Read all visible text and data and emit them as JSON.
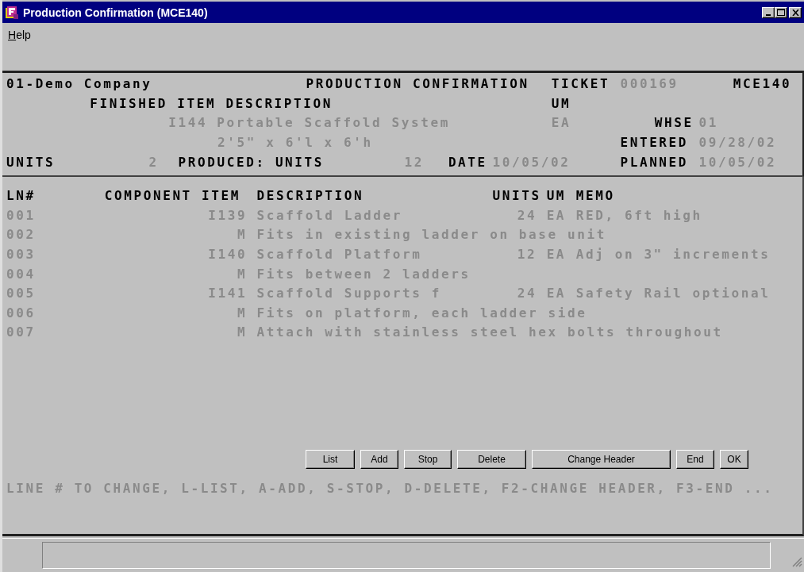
{
  "window": {
    "title": "Production Confirmation (MCE140)"
  },
  "menu": [
    "Help"
  ],
  "header": {
    "company": "01-Demo Company",
    "title": "PRODUCTION CONFIRMATION",
    "ticket_label": "TICKET",
    "ticket": "000169",
    "program": "MCE140",
    "description_label": "FINISHED ITEM DESCRIPTION",
    "um_label": "UM",
    "item": "I144 Portable Scaffold System",
    "um": "EA",
    "whse_label": "WHSE",
    "whse": "01",
    "item_size": "2'5\" x 6'l x 6'h",
    "entered_label": "ENTERED",
    "entered": "09/28/02",
    "units_label": "UNITS",
    "units": "2",
    "produced_label": "PRODUCED: UNITS",
    "produced": "12",
    "date_label": "DATE",
    "date": "10/05/02",
    "planned_label": "PLANNED",
    "planned": "10/05/02"
  },
  "table": {
    "columns": [
      "LN#",
      "COMPONENT ITEM",
      "DESCRIPTION",
      "UNITS",
      "UM",
      "MEMO"
    ],
    "rows": [
      {
        "line": "001",
        "item": "I139",
        "description": "Scaffold Ladder",
        "units": "24",
        "um": "EA",
        "memo": "RED, 6ft high"
      },
      {
        "line": "002",
        "item": "M",
        "description": "Fits in existing ladder on base unit"
      },
      {
        "line": "003",
        "item": "I140",
        "description": "Scaffold Platform",
        "units": "12",
        "um": "EA",
        "memo": "Adj on 3\" increments"
      },
      {
        "line": "004",
        "item": "M",
        "description": "Fits between 2 ladders"
      },
      {
        "line": "005",
        "item": "I141",
        "description": "Scaffold Supports f",
        "units": "24",
        "um": "EA",
        "memo": "Safety Rail optional"
      },
      {
        "line": "006",
        "item": "M",
        "description": "Fits on platform, each ladder side"
      },
      {
        "line": "007",
        "item": "M",
        "description": "Attach with stainless steel hex bolts throughout"
      }
    ]
  },
  "buttons": [
    "List",
    "Add",
    "Stop",
    "Delete",
    "Change Header",
    "End",
    "OK"
  ],
  "prompt": "LINE # TO CHANGE, L-LIST, A-ADD, S-STOP, D-DELETE, F2-CHANGE HEADER, F3-END ..."
}
